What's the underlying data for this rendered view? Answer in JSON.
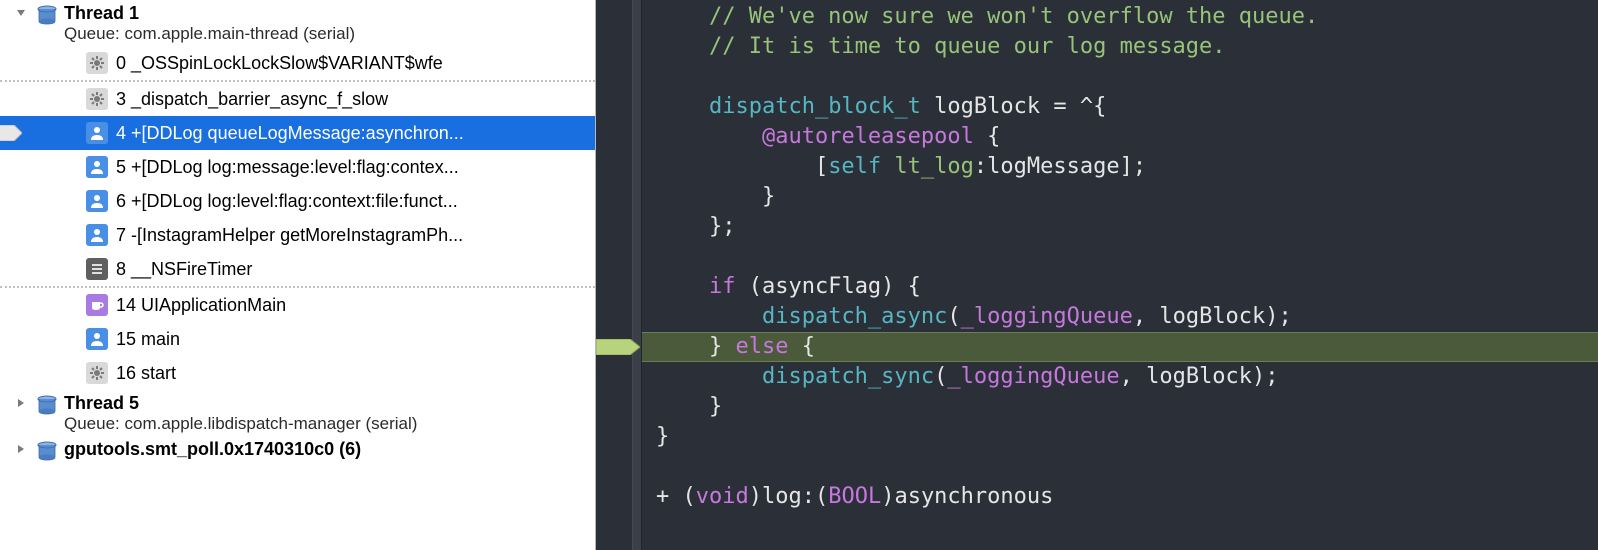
{
  "sidebar": {
    "threads": [
      {
        "title": "Thread 1",
        "subtitle": "Queue: com.apple.main-thread (serial)",
        "expanded": true,
        "frames": [
          {
            "icon": "gear",
            "text": "0 _OSSpinLockLockSlow$VARIANT$wfe",
            "selected": false,
            "sep_after": true
          },
          {
            "icon": "gear",
            "text": "3 _dispatch_barrier_async_f_slow",
            "selected": false
          },
          {
            "icon": "user",
            "text": "4 +[DDLog queueLogMessage:asynchron...",
            "selected": true,
            "breakpoint": true
          },
          {
            "icon": "user",
            "text": "5 +[DDLog log:message:level:flag:contex...",
            "selected": false
          },
          {
            "icon": "user",
            "text": "6 +[DDLog log:level:flag:context:file:funct...",
            "selected": false
          },
          {
            "icon": "user",
            "text": "7 -[InstagramHelper getMoreInstagramPh...",
            "selected": false
          },
          {
            "icon": "list",
            "text": "8 __NSFireTimer",
            "selected": false,
            "sep_after": true
          },
          {
            "icon": "cup",
            "text": "14 UIApplicationMain",
            "selected": false
          },
          {
            "icon": "user",
            "text": "15 main",
            "selected": false
          },
          {
            "icon": "gear",
            "text": "16 start",
            "selected": false
          }
        ]
      },
      {
        "title": "Thread 5",
        "subtitle": "Queue: com.apple.libdispatch-manager (serial)",
        "expanded": false
      },
      {
        "title": "gputools.smt_poll.0x1740310c0 (6)",
        "subtitle": "",
        "expanded": false,
        "bold": true
      }
    ]
  },
  "editor": {
    "lines": [
      {
        "tokens": [
          {
            "t": "    // We've now sure we won't overflow the queue.",
            "c": "comment"
          }
        ]
      },
      {
        "tokens": [
          {
            "t": "    // It is time to queue our log message.",
            "c": "comment"
          }
        ]
      },
      {
        "tokens": []
      },
      {
        "tokens": [
          {
            "t": "    ",
            "c": "punc"
          },
          {
            "t": "dispatch_block_t",
            "c": "type"
          },
          {
            "t": " logBlock = ^{",
            "c": "punc"
          }
        ]
      },
      {
        "tokens": [
          {
            "t": "        ",
            "c": "punc"
          },
          {
            "t": "@autoreleasepool",
            "c": "keyword"
          },
          {
            "t": " {",
            "c": "punc"
          }
        ]
      },
      {
        "tokens": [
          {
            "t": "            [",
            "c": "punc"
          },
          {
            "t": "self",
            "c": "self"
          },
          {
            "t": " ",
            "c": "punc"
          },
          {
            "t": "lt_log",
            "c": "func"
          },
          {
            "t": ":logMessage];",
            "c": "punc"
          }
        ]
      },
      {
        "tokens": [
          {
            "t": "        }",
            "c": "punc"
          }
        ]
      },
      {
        "tokens": [
          {
            "t": "    };",
            "c": "punc"
          }
        ]
      },
      {
        "tokens": []
      },
      {
        "tokens": [
          {
            "t": "    ",
            "c": "punc"
          },
          {
            "t": "if",
            "c": "keyword"
          },
          {
            "t": " (asyncFlag) {",
            "c": "punc"
          }
        ]
      },
      {
        "tokens": [
          {
            "t": "        ",
            "c": "punc"
          },
          {
            "t": "dispatch_async",
            "c": "type"
          },
          {
            "t": "(",
            "c": "punc"
          },
          {
            "t": "_loggingQueue",
            "c": "member"
          },
          {
            "t": ", logBlock);",
            "c": "punc"
          }
        ],
        "highlight": true
      },
      {
        "tokens": [
          {
            "t": "    } ",
            "c": "punc"
          },
          {
            "t": "else",
            "c": "keyword"
          },
          {
            "t": " {",
            "c": "punc"
          }
        ]
      },
      {
        "tokens": [
          {
            "t": "        ",
            "c": "punc"
          },
          {
            "t": "dispatch_sync",
            "c": "type"
          },
          {
            "t": "(",
            "c": "punc"
          },
          {
            "t": "_loggingQueue",
            "c": "member"
          },
          {
            "t": ", logBlock);",
            "c": "punc"
          }
        ]
      },
      {
        "tokens": [
          {
            "t": "    }",
            "c": "punc"
          }
        ]
      },
      {
        "tokens": [
          {
            "t": "}",
            "c": "punc"
          }
        ]
      },
      {
        "tokens": []
      },
      {
        "tokens": [
          {
            "t": "+ (",
            "c": "punc"
          },
          {
            "t": "void",
            "c": "keyword"
          },
          {
            "t": ")log:(",
            "c": "punc"
          },
          {
            "t": "BOOL",
            "c": "keyword"
          },
          {
            "t": ")asynchronous",
            "c": "punc"
          }
        ]
      }
    ]
  }
}
